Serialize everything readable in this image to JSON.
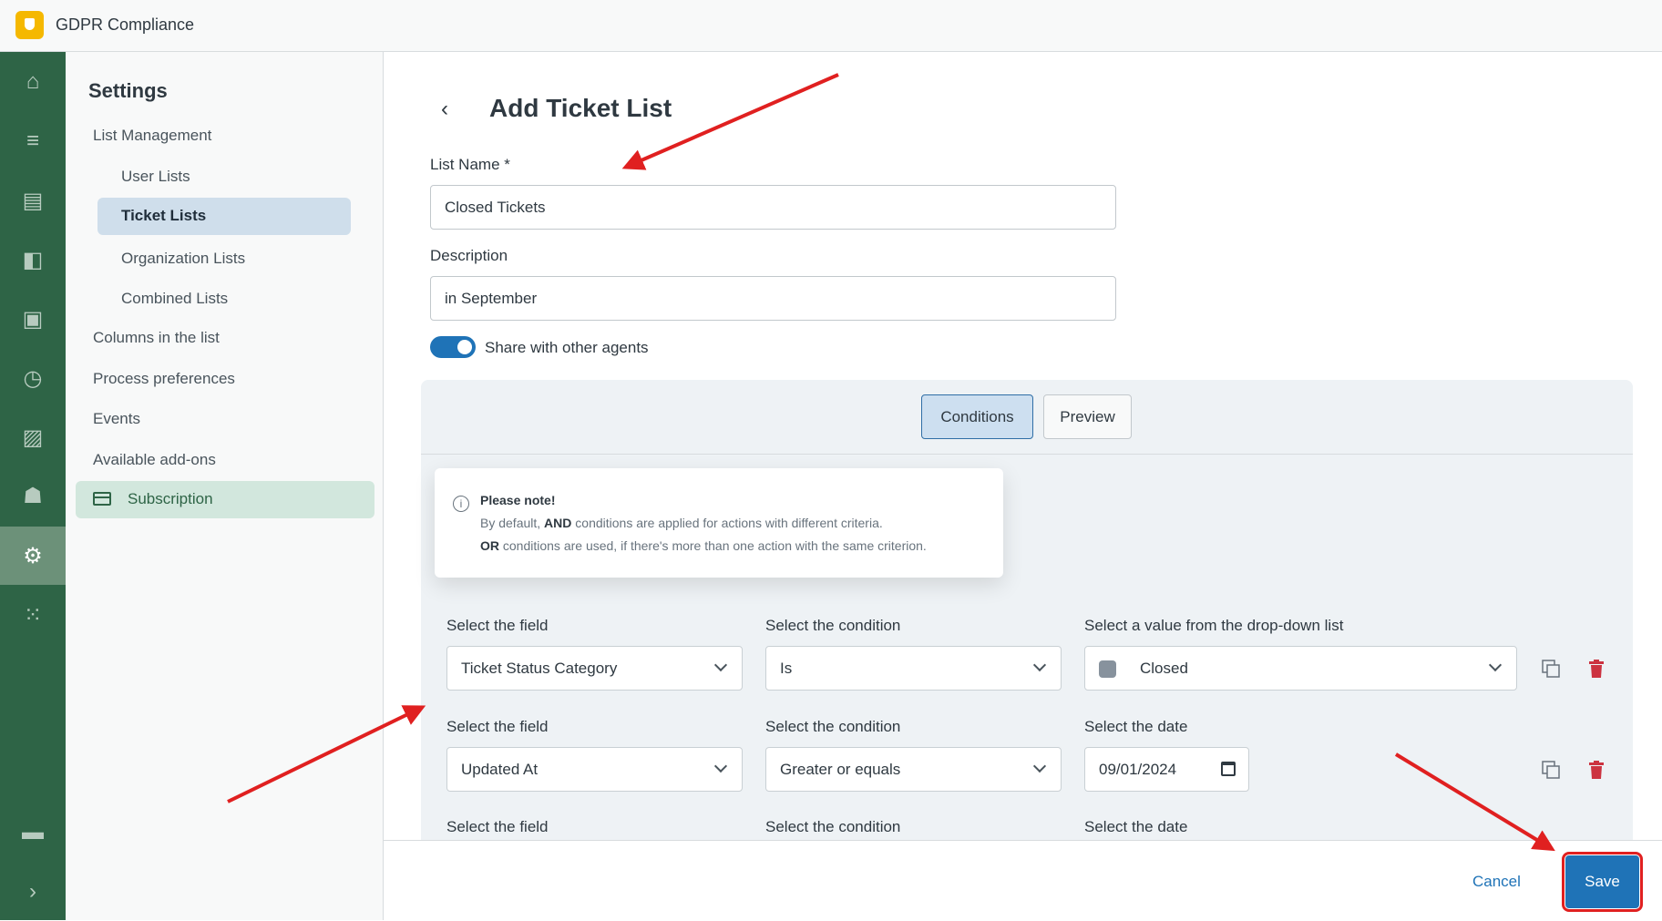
{
  "app": {
    "title": "GDPR Compliance"
  },
  "rail": {
    "icons": [
      "home-icon",
      "views-icon",
      "inbox-icon",
      "contacts-icon",
      "badge-icon",
      "clock-icon",
      "reports-icon",
      "users-lock-icon",
      "gear-icon",
      "apps-icon",
      "chat-icon",
      "expand-icon"
    ],
    "active": "gear-icon"
  },
  "settings": {
    "title": "Settings",
    "items": [
      "List Management",
      "User Lists",
      "Ticket Lists",
      "Organization Lists",
      "Combined Lists",
      "Columns in the list",
      "Process preferences",
      "Events",
      "Available add-ons",
      "Subscription"
    ],
    "selected": "Ticket Lists"
  },
  "form": {
    "title": "Add Ticket List",
    "list_name_label": "List Name *",
    "list_name_value": "Closed Tickets",
    "description_label": "Description",
    "description_value": "in September",
    "share_label": "Share with other agents",
    "share_enabled": true
  },
  "tabs": [
    "Conditions",
    "Preview"
  ],
  "note": {
    "title": "Please note!",
    "line1_pre": "By default, ",
    "line1_bold": "AND",
    "line1_post": " conditions are applied for actions with different criteria.",
    "line2_bold": "OR",
    "line2_post": " conditions are used, if there's more than one action with the same criterion."
  },
  "conditions": [
    {
      "field_label": "Select the field",
      "field": "Ticket Status Category",
      "cond_label": "Select the condition",
      "cond": "Is",
      "value_label": "Select a value from the drop-down list",
      "value": "Closed",
      "value_swatch": "#87929d"
    },
    {
      "field_label": "Select the field",
      "field": "Updated At",
      "cond_label": "Select the condition",
      "cond": "Greater or equals",
      "value_label": "Select the date",
      "value": "09/01/2024"
    },
    {
      "field_label": "Select the field",
      "cond_label": "Select the condition",
      "value_label": "Select the date"
    }
  ],
  "footer": {
    "cancel": "Cancel",
    "save": "Save"
  },
  "colors": {
    "rail": "#2e6446",
    "primary": "#1f73b7",
    "annotation": "#e02020"
  }
}
